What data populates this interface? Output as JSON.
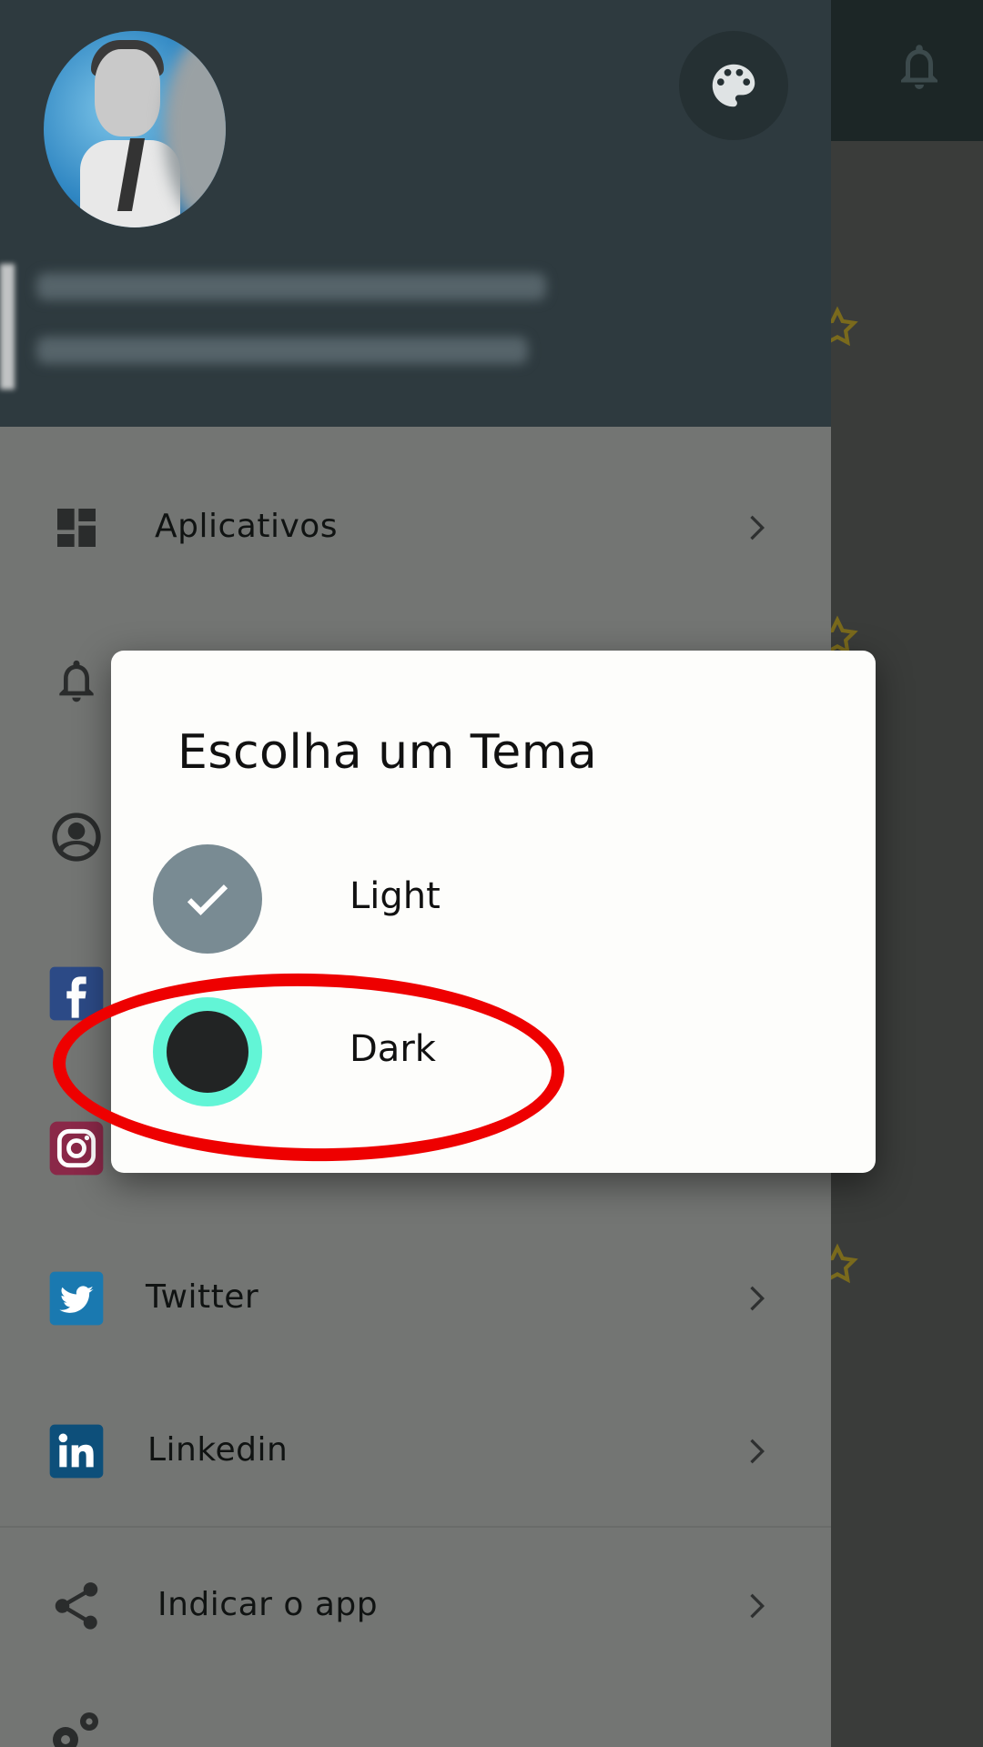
{
  "drawer": {
    "menu": [
      {
        "label": "Aplicativos",
        "icon": "dashboard-icon"
      },
      {
        "label": "",
        "icon": "bell-icon"
      },
      {
        "label": "",
        "icon": "account-circle-icon"
      },
      {
        "label": "",
        "icon": "facebook-icon"
      },
      {
        "label": "",
        "icon": "instagram-icon"
      },
      {
        "label": "Twitter",
        "icon": "twitter-icon"
      },
      {
        "label": "Linkedin",
        "icon": "linkedin-icon"
      },
      {
        "label": "Indicar o app",
        "icon": "share-icon"
      },
      {
        "label": "",
        "icon": "settings-icon"
      }
    ]
  },
  "dialog": {
    "title": "Escolha um Tema",
    "options": [
      {
        "label": "Light",
        "selected": true,
        "color": "#798b93"
      },
      {
        "label": "Dark",
        "selected": false,
        "color": "#222424",
        "ring": "#62f5d6"
      }
    ]
  },
  "colors": {
    "header": "#2e3a3f",
    "drawer_bg": "#737573",
    "highlight": "#ee0000",
    "facebook": "#3b5998",
    "twitter": "#1da1f2",
    "linkedin": "#0e76a8",
    "instagram": "#c13584"
  }
}
